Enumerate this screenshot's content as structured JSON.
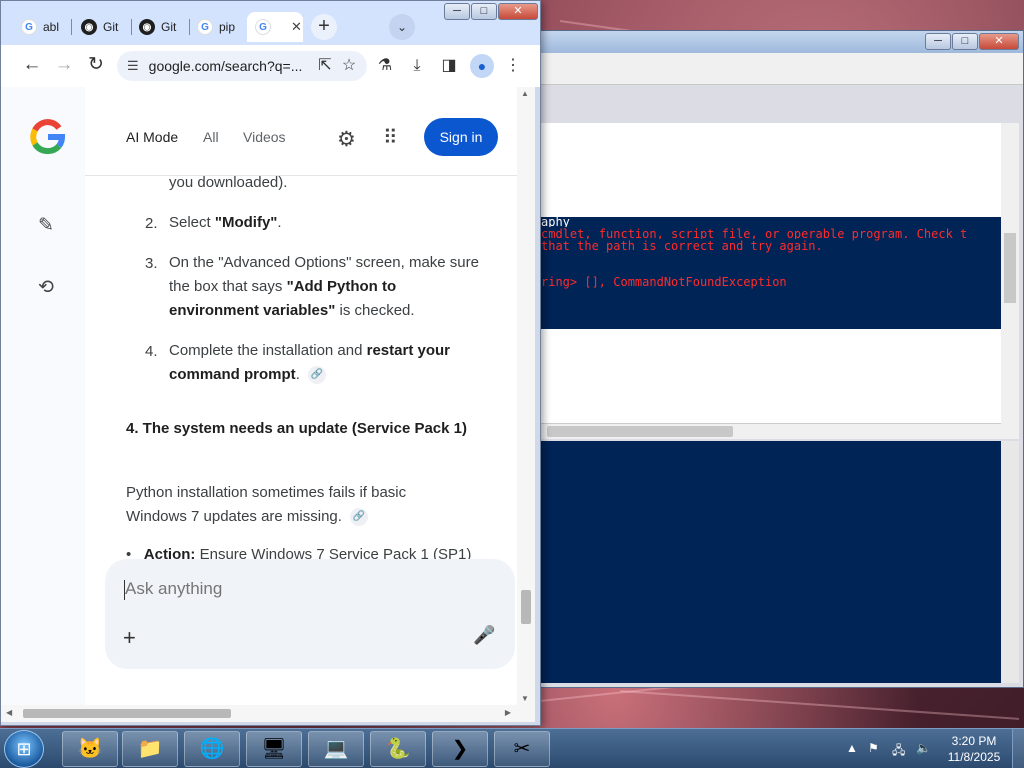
{
  "browser": {
    "tabs": [
      {
        "label": "abl",
        "icon": "google-icon"
      },
      {
        "label": "Git",
        "icon": "github-icon"
      },
      {
        "label": "Git",
        "icon": "github-icon"
      },
      {
        "label": "pip",
        "icon": "google-icon"
      },
      {
        "label": "",
        "icon": "google-icon",
        "active": true
      }
    ],
    "url": "google.com/search?q=..."
  },
  "google": {
    "nav": {
      "ai_mode": "AI Mode",
      "all": "All",
      "videos": "Videos",
      "sign_in": "Sign in"
    },
    "content": {
      "fragment": "you downloaded).",
      "step2_num": "2.",
      "step2_pre": "Select ",
      "step2_bold": "\"Modify\"",
      "step2_post": ".",
      "step3_num": "3.",
      "step3_pre": "On the \"Advanced Options\" screen, make sure the box that says ",
      "step3_bold": "\"Add Python to environment variables\"",
      "step3_post": " is checked.",
      "step4_num": "4.",
      "step4_pre": "Complete the installation and ",
      "step4_bold": "restart your command prompt",
      "step4_post": ".",
      "heading": "4. The system needs an update (Service Pack 1)",
      "para": "Python installation sometimes fails if basic Windows 7 updates are missing.",
      "action_label": "Action:",
      "action_text": " Ensure Windows 7 Service Pack 1 (SP1)"
    },
    "ask_placeholder": "Ask anything"
  },
  "console": {
    "line1": "aphy",
    "line2": "cmdlet, function, script file, or operable program. Check t",
    "line3": "that the path is correct and try again.",
    "line4": "ring> [], CommandNotFoundException"
  },
  "taskbar": {
    "time": "3:20 PM",
    "date": "11/8/2025"
  },
  "colors": {
    "signin": "#0b57d0",
    "console_bg": "#012456",
    "console_error": "#ff2b2b"
  }
}
